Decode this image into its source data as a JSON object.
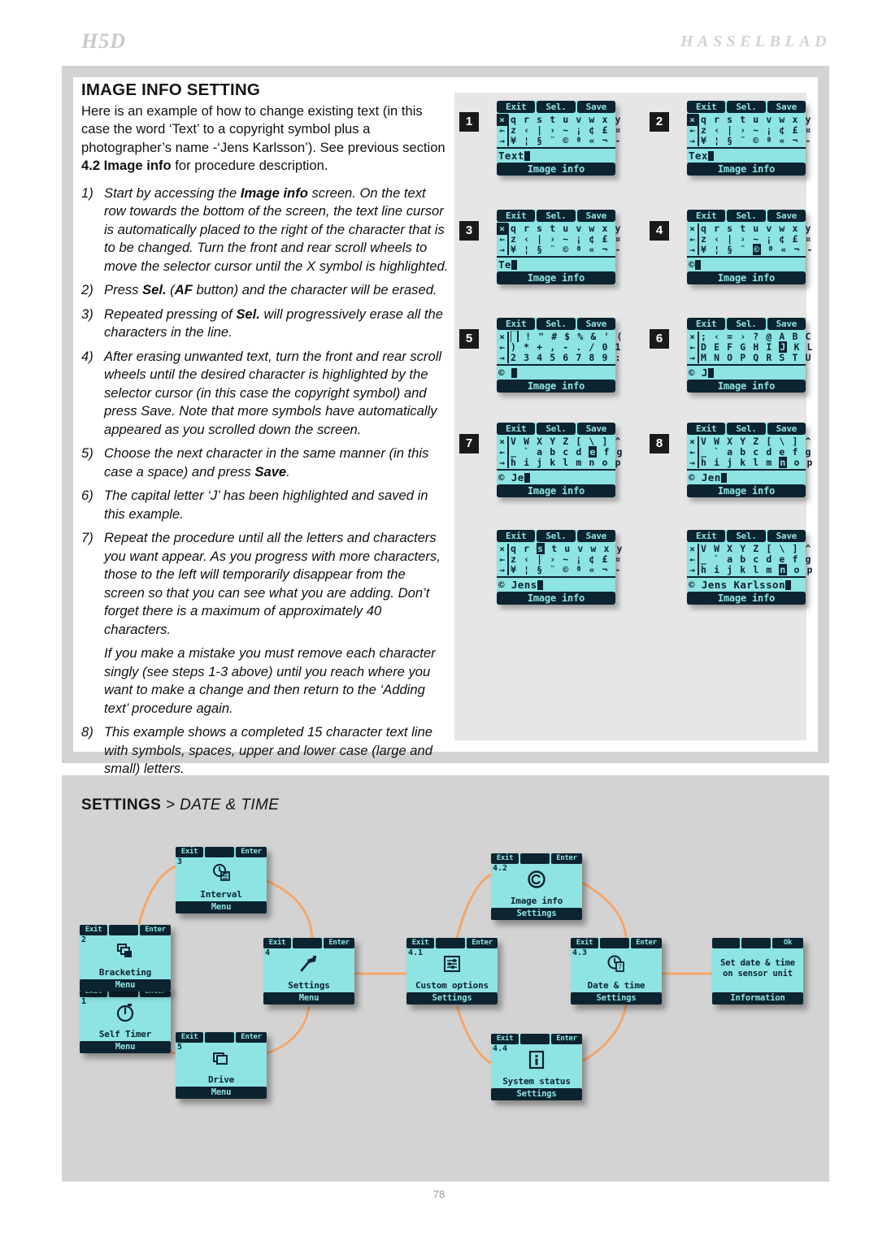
{
  "header": {
    "model": "H5D",
    "brand": "HASSELBLAD"
  },
  "page_number": "78",
  "section": {
    "title": "IMAGE INFO SETTING",
    "intro_1": "Here is an example of how to change existing text (in this case the word ‘Text’ to a copyright symbol plus a photographer’s name -‘Jens Karlsson’). See previous section ",
    "intro_bold": "4.2 Image info",
    "intro_2": " for procedure description.",
    "steps": [
      {
        "num": "1)",
        "pre": "Start by accessing the ",
        "bold": "Image info",
        "post": " screen. On the text row towards the bottom of the screen, the text line cursor is automatically placed to the right of the character that is to be changed. Turn the front and rear scroll wheels to move the selector cursor until the X symbol is highlighted."
      },
      {
        "num": "2)",
        "pre": "Press ",
        "bold": "Sel.",
        "post": " (AF button) and the character will be erased.",
        "bold2": "AF"
      },
      {
        "num": "3)",
        "pre": "Repeated pressing of ",
        "bold": "Sel.",
        "post": " will progressively erase all the characters in the line."
      },
      {
        "num": "4)",
        "pre": "After erasing unwanted text, turn the front and rear scroll wheels until the desired character is highlighted by the selector cursor (in this case the copyright symbol) and press Save. Note that more symbols have automatically appeared as you scrolled down the screen.",
        "bold": "",
        "post": ""
      },
      {
        "num": "5)",
        "pre": "Choose the next character in the same manner (in this case a space) and press ",
        "bold": "Save",
        "post": "."
      },
      {
        "num": "6)",
        "pre": "The capital letter ‘J’ has been highlighted and saved in this example.",
        "bold": "",
        "post": ""
      },
      {
        "num": "7)",
        "pre": "Repeat the procedure until all the letters and characters you want appear. As you progress with more characters, those to the left will temporarily disappear from the screen so that you can see what you are adding. Don’t forget there is a maximum of approximately 40 characters.",
        "bold": "",
        "post": ""
      },
      {
        "num": "",
        "pre": "If you make a mistake you must remove each character singly (see steps 1-3 above) until you reach where you want to make a change and then return to the ‘Adding text’ procedure again.",
        "bold": "",
        "post": ""
      },
      {
        "num": "8)",
        "pre": "This example shows a completed 15 character text line with symbols, spaces, upper and lower case (large and small) letters.",
        "bold": "",
        "post": ""
      }
    ]
  },
  "lcd_common": {
    "btn_exit": "Exit",
    "btn_sel": "Sel.",
    "btn_save": "Save",
    "footer": "Image info",
    "arrow_x": "☒",
    "arrow_x_plain": "×",
    "arrow_left": "←",
    "arrow_right": "→"
  },
  "lcd_screens": [
    {
      "badge": "1",
      "arrow_sel": true,
      "rows": [
        "q r s t u v w x y",
        "z ‹ | › ~ ¡ ¢ £ ¤",
        "¥ ¦ § ¨ © ª « ¬ -"
      ],
      "highlight": null,
      "text": "Text"
    },
    {
      "badge": "2",
      "arrow_sel": true,
      "rows": [
        "q r s t u v w x y",
        "z ‹ | › ~ ¡ ¢ £ ¤",
        "¥ ¦ § ¨ © ª « ¬ -"
      ],
      "highlight": null,
      "text": "Tex"
    },
    {
      "badge": "3",
      "arrow_sel": true,
      "rows": [
        "q r s t u v w x y",
        "z ‹ | › ~ ¡ ¢ £ ¤",
        "¥ ¦ § ¨ © ª « ¬ -"
      ],
      "highlight": null,
      "text": "Te"
    },
    {
      "badge": "4",
      "arrow_sel": false,
      "rows": [
        "q r s t u v w x y",
        "z ‹ | › ~ ¡ ¢ £ ¤",
        "¥ ¦ § ¨ © ª « ¬ -"
      ],
      "highlight": {
        "row": 2,
        "index": 4
      },
      "text": "©"
    },
    {
      "badge": "5",
      "arrow_sel": false,
      "rows": [
        "█ ! \" # $ % & ' (",
        ") * + , - . / 0 1",
        "2 3 4 5 6 7 8 9 :"
      ],
      "highlight": {
        "row": 0,
        "index": 0
      },
      "text": "© "
    },
    {
      "badge": "6",
      "arrow_sel": false,
      "rows": [
        "; ‹ = › ? @ A B C",
        "D E F G H I J K L",
        "M N O P Q R S T U"
      ],
      "highlight": {
        "row": 1,
        "index": 6
      },
      "text": "© J"
    },
    {
      "badge": "7",
      "arrow_sel": false,
      "rows": [
        "V W X Y Z [ \\ ] ^",
        "_ ` a b c d e f g",
        "h i j k l m n o p"
      ],
      "highlight": {
        "row": 1,
        "index": 6
      },
      "text": "© Je"
    },
    {
      "badge": "8",
      "arrow_sel": false,
      "rows": [
        "V W X Y Z [ \\ ] ^",
        "_ ` a b c d e f g",
        "h i j k l m n o p"
      ],
      "highlight": {
        "row": 2,
        "index": 6
      },
      "text": "© Jen"
    },
    {
      "badge": "",
      "arrow_sel": false,
      "rows": [
        "q r s t u v w x y",
        "z ‹ | › ~ ¡ ¢ £ ¤",
        "¥ ¦ § ¨ © ª « ¬ -"
      ],
      "highlight": {
        "row": 0,
        "index": 2
      },
      "text": "© Jens"
    },
    {
      "badge": "",
      "arrow_sel": false,
      "rows": [
        "V W X Y Z [ \\ ] ^",
        "_ ` a b c d e f g",
        "h i j k l m n o p"
      ],
      "highlight": {
        "row": 2,
        "index": 6
      },
      "text": "© Jens Karlsson"
    }
  ],
  "diagram": {
    "title_bold": "SETTINGS",
    "title_sep": " > ",
    "title_italic": "DATE & TIME",
    "btn_exit": "Exit",
    "btn_enter": "Enter",
    "btn_ok": "Ok",
    "nodes": [
      {
        "id": "self-timer",
        "index": "1",
        "label": "Self Timer",
        "footer": "Menu",
        "icon": "self-timer-icon"
      },
      {
        "id": "bracketing",
        "index": "2",
        "label": "Bracketing",
        "footer": "Menu",
        "icon": "bracketing-icon"
      },
      {
        "id": "interval",
        "index": "3",
        "label": "Interval",
        "footer": "Menu",
        "icon": "interval-icon"
      },
      {
        "id": "settings",
        "index": "4",
        "label": "Settings",
        "footer": "Menu",
        "icon": "settings-icon"
      },
      {
        "id": "drive",
        "index": "5",
        "label": "Drive",
        "footer": "Menu",
        "icon": "drive-icon"
      },
      {
        "id": "custom-options",
        "index": "4.1",
        "label": "Custom options",
        "footer": "Settings",
        "icon": "sliders-icon"
      },
      {
        "id": "image-info",
        "index": "4.2",
        "label": "Image info",
        "footer": "Settings",
        "icon": "copyright-icon"
      },
      {
        "id": "date-time",
        "index": "4.3",
        "label": "Date & time",
        "footer": "Settings",
        "icon": "clock-calendar-icon"
      },
      {
        "id": "system-status",
        "index": "4.4",
        "label": "System status",
        "footer": "Settings",
        "icon": "info-icon"
      },
      {
        "id": "information",
        "index": "",
        "label": "Set date & time on sensor unit",
        "footer": "Information",
        "icon": "none"
      }
    ]
  }
}
